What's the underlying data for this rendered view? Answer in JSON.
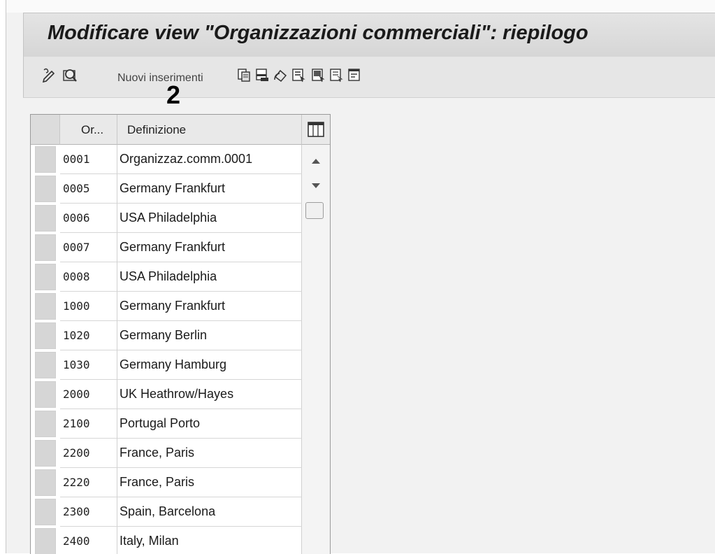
{
  "window": {
    "title": "Modificare view \"Organizzazioni commerciali\": riepilogo"
  },
  "toolbar": {
    "new_entries_label": "Nuovi inserimenti",
    "icons": [
      "change-display-icon",
      "detail-icon",
      "copy-icon",
      "delete-icon",
      "undo-icon",
      "select-all-icon",
      "select-block-icon",
      "deselect-all-icon",
      "config-icon"
    ]
  },
  "annotation": {
    "marker": "2"
  },
  "table": {
    "columns": {
      "code": "Or...",
      "definition": "Definizione"
    },
    "rows": [
      {
        "code": "0001",
        "definition": "Organizzaz.comm.0001"
      },
      {
        "code": "0005",
        "definition": "Germany Frankfurt"
      },
      {
        "code": "0006",
        "definition": "USA Philadelphia"
      },
      {
        "code": "0007",
        "definition": "Germany Frankfurt"
      },
      {
        "code": "0008",
        "definition": "USA Philadelphia"
      },
      {
        "code": "1000",
        "definition": "Germany Frankfurt"
      },
      {
        "code": "1020",
        "definition": "Germany Berlin"
      },
      {
        "code": "1030",
        "definition": "Germany Hamburg"
      },
      {
        "code": "2000",
        "definition": "UK Heathrow/Hayes"
      },
      {
        "code": "2100",
        "definition": "Portugal Porto"
      },
      {
        "code": "2200",
        "definition": "France, Paris"
      },
      {
        "code": "2220",
        "definition": "France, Paris"
      },
      {
        "code": "2300",
        "definition": "Spain, Barcelona"
      },
      {
        "code": "2400",
        "definition": "Italy, Milan"
      }
    ]
  }
}
